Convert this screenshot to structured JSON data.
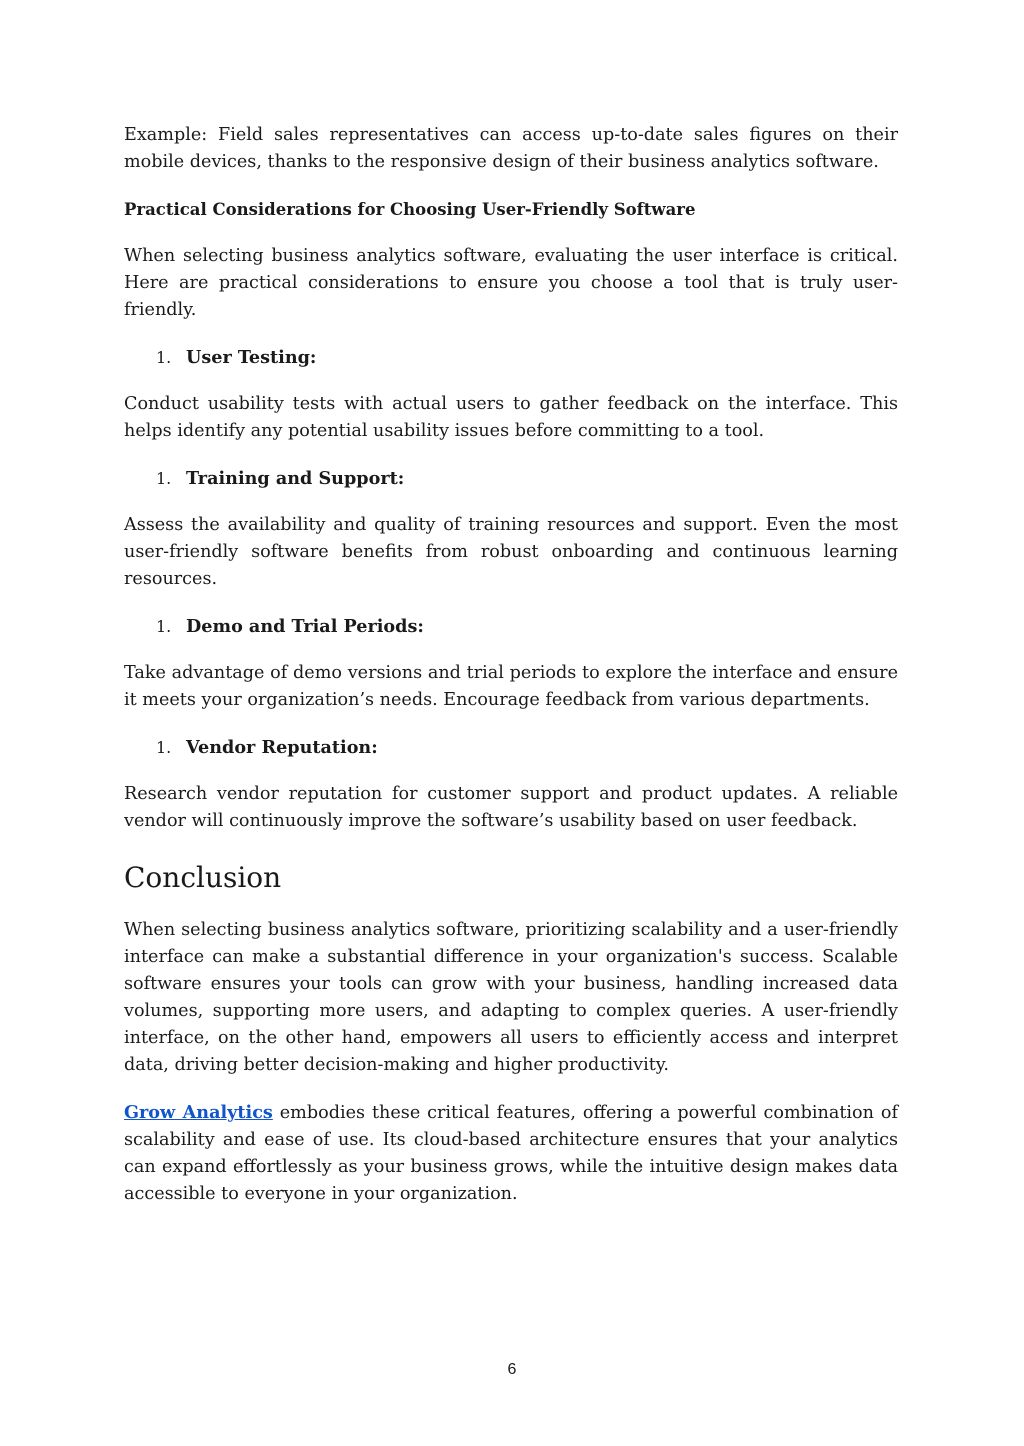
{
  "example_paragraph": "Example: Field sales representatives can access up-to-date sales figures on their mobile devices, thanks to the responsive design of their business analytics software.",
  "subheading": "Practical Considerations for Choosing User-Friendly Software",
  "intro_paragraph": "When selecting business analytics software, evaluating the user interface is critical. Here are practical considerations to ensure you choose a tool that is truly user-friendly.",
  "considerations": [
    {
      "number": "1.",
      "label": "User Testing:",
      "text": "Conduct usability tests with actual users to gather feedback on the interface. This helps identify any potential usability issues before committing to a tool."
    },
    {
      "number": "1.",
      "label": "Training and Support:",
      "text": "Assess the availability and quality of training resources and support. Even the most user-friendly software benefits from robust onboarding and continuous learning resources."
    },
    {
      "number": "1.",
      "label": "Demo and Trial Periods:",
      "text": "Take advantage of demo versions and trial periods to explore the interface and ensure it meets your organization’s needs. Encourage feedback from various departments."
    },
    {
      "number": "1.",
      "label": "Vendor Reputation:",
      "text": "Research vendor reputation for customer support and product updates. A reliable vendor will continuously improve the software’s usability based on user feedback."
    }
  ],
  "conclusion": {
    "heading": "Conclusion",
    "paragraph1": "When selecting business analytics software, prioritizing scalability and a user-friendly interface can make a substantial difference in your organization's success. Scalable software ensures your tools can grow with your business, handling increased data volumes, supporting more users, and adapting to complex queries. A user-friendly interface, on the other hand, empowers all users to efficiently access and interpret data, driving better decision-making and higher productivity.",
    "link_text": "Grow Analytics",
    "paragraph2_rest": " embodies these critical features, offering a powerful combination of scalability and ease of use. Its cloud-based architecture ensures that your analytics can expand effortlessly as your business grows, while the intuitive design makes data accessible to everyone in your organization."
  },
  "page_number": "6",
  "colors": {
    "link": "#1155cc",
    "text": "#1a1a1a"
  }
}
